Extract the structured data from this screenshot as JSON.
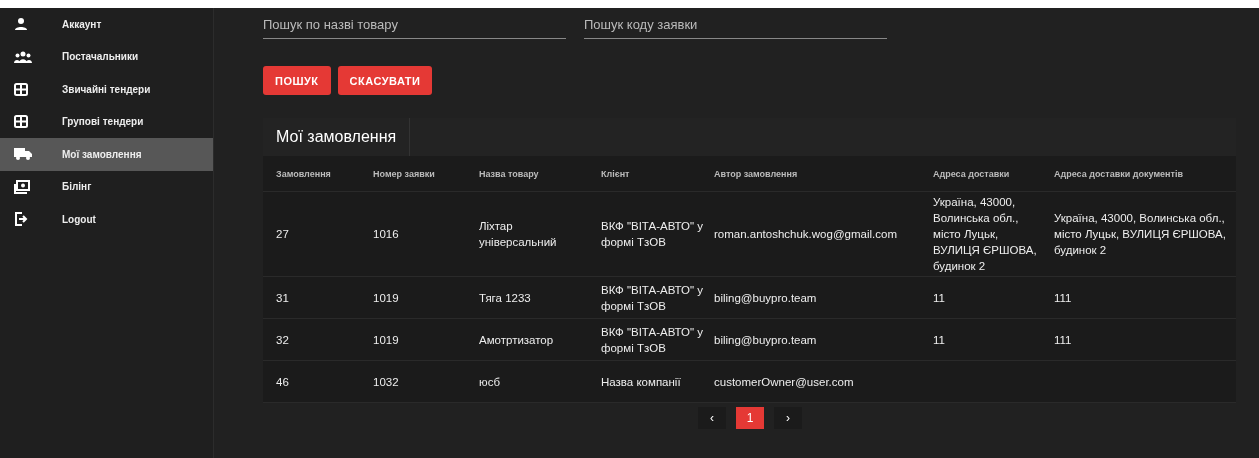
{
  "sidebar": {
    "items": [
      {
        "label": "Аккаунт",
        "selected": false
      },
      {
        "label": "Постачальники",
        "selected": false
      },
      {
        "label": "Звичайні тендери",
        "selected": false
      },
      {
        "label": "Групові тендери",
        "selected": false
      },
      {
        "label": "Мої замовлення",
        "selected": true
      },
      {
        "label": "Білінг",
        "selected": false
      },
      {
        "label": "Logout",
        "selected": false
      }
    ]
  },
  "search": {
    "fields": [
      {
        "placeholder": "Пошук по назві товару"
      },
      {
        "placeholder": "Пошук коду заявки"
      }
    ],
    "buttons": [
      "ПОШУК",
      "СКАСУВАТИ"
    ]
  },
  "table": {
    "title": "Мої замовлення",
    "columns": [
      "Замовлення",
      "Номер заявки",
      "Назва товару",
      "Клієнт",
      "Автор замовлення",
      "Адреса доставки",
      "Адреса доставки документів"
    ],
    "rows": [
      {
        "cells": [
          "27",
          "1016",
          "Ліхтар універсальний",
          "ВКФ \"ВІТА-АВТО\" у формі ТзОВ",
          "roman.antoshchuk.wog@gmail.com",
          "Україна, 43000, Волинська обл., місто Луцьк, ВУЛИЦЯ ЄРШОВА, будинок 2",
          "Україна, 43000, Волинська обл., місто Луцьк, ВУЛИЦЯ ЄРШОВА, будинок 2"
        ]
      },
      {
        "cells": [
          "31",
          "1019",
          "Тяга 1233",
          "ВКФ \"ВІТА-АВТО\" у формі ТзОВ",
          "biling@buypro.team",
          "11",
          "111"
        ]
      },
      {
        "cells": [
          "32",
          "1019",
          "Амотртизатор",
          "ВКФ \"ВІТА-АВТО\" у формі ТзОВ",
          "biling@buypro.team",
          "11",
          "111"
        ]
      },
      {
        "cells": [
          "46",
          "1032",
          "юсб",
          "Назва компанії",
          "customerOwner@user.com"
        ]
      }
    ]
  },
  "pagination": {
    "prev": "‹",
    "next": "›",
    "pages": [
      {
        "label": "1",
        "selected": true
      }
    ]
  }
}
